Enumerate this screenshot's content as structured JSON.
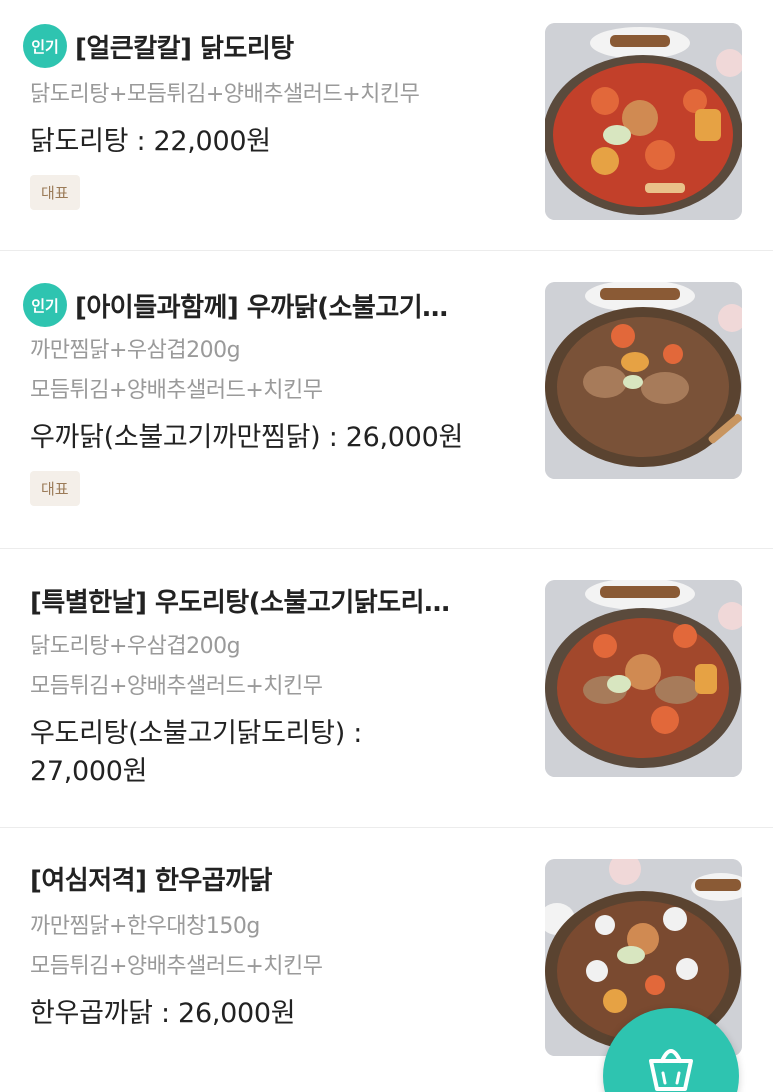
{
  "items": [
    {
      "badge": "인기",
      "title": "[얼큰칼칼] 닭도리탕",
      "desc": [
        "닭도리탕+모듬튀김+양배추샐러드+치킨무"
      ],
      "price": "닭도리탕 : 22,000원",
      "tag": "대표",
      "image_icon": "braised-chicken-stew-photo"
    },
    {
      "badge": "인기",
      "title": "[아이들과함께] 우까닭(소불고기…",
      "desc": [
        "까만찜닭+우삼겹200g",
        "모듬튀김+양배추샐러드+치킨무"
      ],
      "price": "우까닭(소불고기까만찜닭) : 26,000원",
      "tag": "대표",
      "image_icon": "bulgogi-jjimdak-photo"
    },
    {
      "title": "[특별한날] 우도리탕(소불고기닭도리…",
      "desc": [
        "닭도리탕+우삼겹200g",
        "모듬튀김+양배추샐러드+치킨무"
      ],
      "price_lines": [
        "우도리탕(소불고기닭도리탕) :",
        "27,000원"
      ],
      "image_icon": "bulgogi-dakdoritang-photo"
    },
    {
      "title": "[여심저격] 한우곱까닭",
      "desc": [
        "까만찜닭+한우대창150g",
        "모듬튀김+양배추샐러드+치킨무"
      ],
      "price": "한우곱까닭 : 26,000원",
      "image_icon": "hanwoo-gopchang-jjimdak-photo"
    }
  ],
  "cart_button": {
    "icon": "shopping-bag-icon"
  },
  "colors": {
    "accent": "#2ec4b0",
    "tag_bg": "#f4efe9",
    "tag_text": "#9b7b58"
  }
}
